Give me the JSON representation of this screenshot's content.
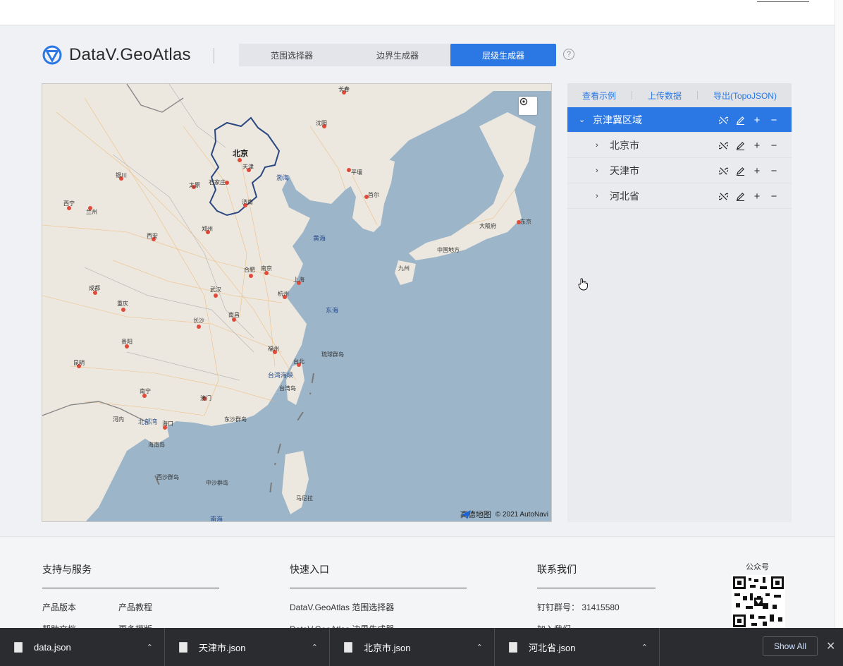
{
  "brand": {
    "name": "DataV.GeoAtlas",
    "accent": "#2b78e4"
  },
  "tabs": [
    {
      "label": "范围选择器",
      "active": false
    },
    {
      "label": "边界生成器",
      "active": false
    },
    {
      "label": "层级生成器",
      "active": true
    }
  ],
  "help": {
    "label": "?"
  },
  "map": {
    "attribution": "© 2021 AutoNavi",
    "provider": "高德地图",
    "labels": {
      "beijing": "北京",
      "tianjin": "天津",
      "shijiazhuang": "石家庄",
      "taiyuan": "太原",
      "jinan": "济南",
      "zhengzhou": "郑州",
      "xian": "西安",
      "lanzhou": "兰州",
      "xining": "西宁",
      "yinchuan": "银川",
      "chengdu": "成都",
      "chongqing": "重庆",
      "wuhan": "武汉",
      "hefei": "合肥",
      "nanjing": "南京",
      "shanghai": "上海",
      "hangzhou": "杭州",
      "nanchang": "南昌",
      "changsha": "长沙",
      "guiyang": "贵阳",
      "kunming": "昆明",
      "nanning": "南宁",
      "fuzhou": "福州",
      "taibei": "台北",
      "haikou": "海口",
      "aomen": "澳门",
      "shenyang": "沈阳",
      "changchun": "长春",
      "pingrang": "平壤",
      "seoul": "首尔",
      "bohai": "渤海",
      "huanghai": "黄海",
      "donghai": "东海",
      "taiwanstrait": "台湾海峡",
      "beibuwan": "北部湾",
      "nanhai": "南海",
      "dongjing": "东京",
      "hanoi": "河内",
      "manila": "马尼拉",
      "zhongshanglingdao": "中沙群岛",
      "xishaqundao": "西沙群岛",
      "dongshaqundao": "东沙群岛",
      "hainan": "海南岛",
      "taiwan": "台湾岛",
      "ryukyu": "琉球群岛",
      "zhongguo": "中国地方",
      "jiuzhou": "九州",
      "dafu": "大阪府"
    }
  },
  "panel": {
    "actions": [
      "查看示例",
      "上传数据",
      "导出(TopoJSON)"
    ],
    "tree": [
      {
        "label": "京津冀区域",
        "level": 0,
        "expanded": true,
        "selected": true
      },
      {
        "label": "北京市",
        "level": 1,
        "expanded": false,
        "selected": false
      },
      {
        "label": "天津市",
        "level": 1,
        "expanded": false,
        "selected": false
      },
      {
        "label": "河北省",
        "level": 0,
        "expanded": false,
        "selected": false
      }
    ]
  },
  "footer": {
    "support": {
      "title": "支持与服务",
      "items": [
        "产品版本",
        "产品教程",
        "帮助文档",
        "更多模版"
      ]
    },
    "quick": {
      "title": "快速入口",
      "items": [
        "DataV.GeoAtlas 范围选择器",
        "DataV.GeoAtlas 边界生成器"
      ]
    },
    "contact": {
      "title": "联系我们",
      "dingtalk": "钉钉群号：  31415580",
      "join": "加入我们"
    },
    "qr_label": "公众号"
  },
  "downloads": [
    {
      "name": "data.json"
    },
    {
      "name": "天津市.json"
    },
    {
      "name": "北京市.json"
    },
    {
      "name": "河北省.json"
    }
  ],
  "downloads_show_all": "Show All"
}
